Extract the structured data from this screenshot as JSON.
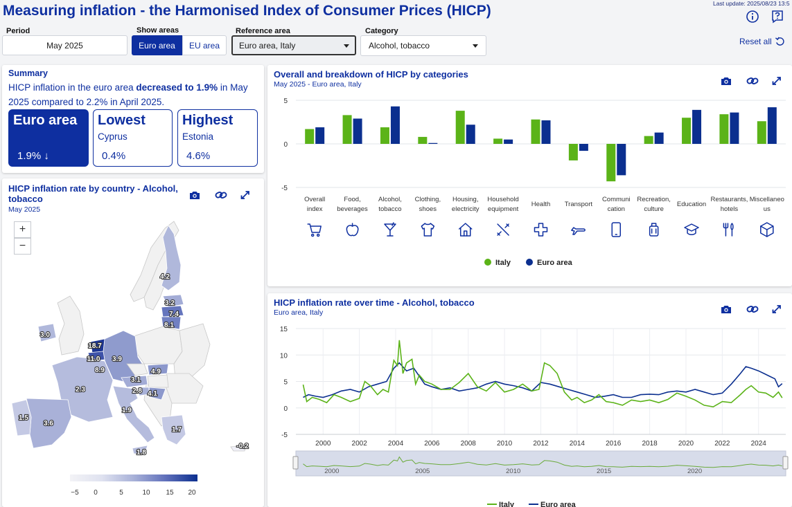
{
  "header": {
    "title": "Measuring inflation - the Harmonised Index of Consumer Prices (HICP)",
    "last_update": "Last update: 2025/08/23 13:5"
  },
  "controls": {
    "period_label": "Period",
    "period_value": "May 2025",
    "show_areas_label": "Show areas",
    "euro_area_btn": "Euro area",
    "eu_area_btn": "EU area",
    "reference_area_label": "Reference area",
    "reference_area_value": "Euro area, Italy",
    "category_label": "Category",
    "category_value": "Alcohol, tobacco",
    "reset_label": "Reset all"
  },
  "summary": {
    "title": "Summary",
    "text_pre": "HICP inflation in the euro area ",
    "text_bold": "decreased to 1.9%",
    "text_post": " in May 2025 compared to 2.2% in April 2025.",
    "cards": [
      {
        "head": "Euro area",
        "sub": "",
        "value": "1.9%",
        "arrow": "↓"
      },
      {
        "head": "Lowest",
        "sub": "Cyprus",
        "value": "0.4%"
      },
      {
        "head": "Highest",
        "sub": "Estonia",
        "value": "4.6%"
      }
    ]
  },
  "map_panel": {
    "title_pre": "HICP inflation rate by country - ",
    "title_bold": "Alcohol, tobacco",
    "subtitle": "May 2025",
    "zoom_in": "+",
    "zoom_out": "−",
    "legend_ticks": [
      "−5",
      "0",
      "5",
      "10",
      "15",
      "20"
    ],
    "labels": [
      "4.2",
      "3.2",
      "7.4",
      "8.1",
      "3.0",
      "18.7",
      "11.0",
      "8.9",
      "3.9",
      "4.9",
      "2.3",
      "3.1",
      "2.8",
      "4.1",
      "1.9",
      "1.5",
      "3.6",
      "1.7",
      "1.8",
      "-0.2"
    ]
  },
  "categories_panel": {
    "title_pre": "Overall and breakdown of HICP ",
    "title_bold": "by categories",
    "subtitle": "May 2025 - Euro area, Italy",
    "legend": [
      "Italy",
      "Euro area"
    ]
  },
  "time_panel": {
    "title_pre": "HICP inflation rate over time - ",
    "title_bold": "Alcohol, tobacco",
    "subtitle": "Euro area, Italy",
    "legend": [
      "Italy",
      "Euro area"
    ],
    "navigator_labels": [
      "2000",
      "2005",
      "2010",
      "2015",
      "2020"
    ]
  },
  "chart_data": [
    {
      "type": "bar",
      "categories": [
        "Overall index",
        "Food, beverages",
        "Alcohol, tobacco",
        "Clothing, shoes",
        "Housing, electricity",
        "Household equipment",
        "Health",
        "Transport",
        "Communication",
        "Recreation, culture",
        "Education",
        "Restaurants, hotels",
        "Miscellaneous"
      ],
      "category_lines": [
        [
          "Overall",
          "index"
        ],
        [
          "Food,",
          "beverages"
        ],
        [
          "Alcohol,",
          "tobacco"
        ],
        [
          "Clothing,",
          "shoes"
        ],
        [
          "Housing,",
          "electricity"
        ],
        [
          "Household",
          "equipment"
        ],
        [
          "Health"
        ],
        [
          "Transport"
        ],
        [
          "Communi",
          "cation"
        ],
        [
          "Recreation,",
          "culture"
        ],
        [
          "Education"
        ],
        [
          "Restaurants,",
          "hotels"
        ],
        [
          "Miscellaneo",
          "us"
        ]
      ],
      "icons": [
        "cart-icon",
        "apple-icon",
        "cocktail-icon",
        "shirt-icon",
        "house-icon",
        "tools-icon",
        "cross-icon",
        "plane-icon",
        "phone-icon",
        "suitcase-icon",
        "graduation-cap-icon",
        "cutlery-icon",
        "box-icon"
      ],
      "series": [
        {
          "name": "Italy",
          "color": "#5bb318",
          "values": [
            1.7,
            3.3,
            1.9,
            0.8,
            3.8,
            0.6,
            2.8,
            -1.9,
            -4.3,
            0.9,
            3.0,
            3.4,
            2.6
          ]
        },
        {
          "name": "Euro area",
          "color": "#0b2f8f",
          "values": [
            1.9,
            2.9,
            4.3,
            0.1,
            2.2,
            0.5,
            2.7,
            -0.8,
            -3.6,
            1.3,
            3.9,
            3.6,
            4.2
          ]
        }
      ],
      "ylim": [
        -5,
        5
      ],
      "yticks": [
        5,
        0,
        -5
      ]
    },
    {
      "type": "line",
      "xlim": [
        1998.5,
        2025.5
      ],
      "ylim": [
        -5,
        15
      ],
      "yticks": [
        15,
        10,
        5,
        0,
        -5
      ],
      "xticks": [
        2000,
        2002,
        2004,
        2006,
        2008,
        2010,
        2012,
        2014,
        2016,
        2018,
        2020,
        2022,
        2024
      ],
      "series": [
        {
          "name": "Italy",
          "color": "#5bb318",
          "x": [
            1998.9,
            1999.1,
            1999.4,
            1999.8,
            2000.2,
            2000.6,
            2001.0,
            2001.5,
            2002.0,
            2002.3,
            2002.6,
            2003.0,
            2003.3,
            2003.6,
            2003.9,
            2004.1,
            2004.2,
            2004.4,
            2004.6,
            2004.9,
            2005.1,
            2005.3,
            2005.6,
            2006.0,
            2006.5,
            2007.0,
            2007.5,
            2008.0,
            2008.5,
            2009.0,
            2009.5,
            2010.0,
            2010.5,
            2011.0,
            2011.5,
            2011.9,
            2012.2,
            2012.5,
            2012.9,
            2013.3,
            2013.7,
            2014.0,
            2014.4,
            2014.8,
            2015.2,
            2015.6,
            2016.0,
            2016.5,
            2017.0,
            2017.5,
            2018.0,
            2018.5,
            2019.0,
            2019.5,
            2020.0,
            2020.5,
            2021.0,
            2021.5,
            2022.0,
            2022.5,
            2023.0,
            2023.3,
            2023.6,
            2024.0,
            2024.4,
            2024.8,
            2025.1,
            2025.3
          ],
          "y": [
            4.4,
            1.2,
            2.0,
            1.6,
            1.0,
            2.5,
            2.0,
            1.2,
            1.8,
            5.0,
            4.2,
            2.5,
            3.5,
            3.0,
            9.0,
            8.0,
            12.8,
            6.5,
            8.5,
            9.2,
            4.5,
            6.2,
            5.0,
            4.5,
            3.5,
            3.5,
            4.8,
            6.5,
            4.0,
            3.2,
            4.8,
            3.0,
            3.5,
            4.5,
            3.2,
            3.5,
            8.5,
            8.0,
            6.5,
            3.0,
            1.5,
            2.0,
            1.0,
            1.5,
            2.5,
            1.2,
            1.0,
            0.5,
            1.5,
            1.2,
            1.5,
            1.0,
            1.6,
            2.8,
            2.2,
            1.5,
            0.5,
            0.2,
            1.2,
            1.0,
            2.5,
            3.5,
            4.2,
            3.0,
            2.8,
            2.0,
            3.0,
            1.9
          ]
        },
        {
          "name": "Euro area",
          "color": "#0b2f8f",
          "x": [
            1998.9,
            1999.2,
            1999.6,
            2000.0,
            2000.5,
            2001.0,
            2001.5,
            2002.0,
            2002.5,
            2003.0,
            2003.5,
            2003.9,
            2004.2,
            2004.6,
            2005.0,
            2005.3,
            2005.6,
            2006.0,
            2006.5,
            2007.0,
            2007.5,
            2008.0,
            2008.5,
            2009.0,
            2009.5,
            2010.0,
            2010.5,
            2011.0,
            2011.5,
            2012.0,
            2012.5,
            2013.0,
            2013.5,
            2014.0,
            2014.5,
            2015.0,
            2015.5,
            2016.0,
            2016.5,
            2017.0,
            2017.5,
            2018.0,
            2018.5,
            2019.0,
            2019.5,
            2020.0,
            2020.5,
            2021.0,
            2021.5,
            2022.0,
            2022.5,
            2023.0,
            2023.3,
            2023.6,
            2024.0,
            2024.3,
            2024.6,
            2024.9,
            2025.1,
            2025.3
          ],
          "y": [
            2.0,
            2.5,
            2.2,
            2.0,
            2.5,
            3.2,
            3.5,
            3.0,
            4.0,
            4.5,
            5.0,
            7.5,
            8.5,
            7.0,
            7.5,
            6.0,
            4.5,
            4.0,
            3.5,
            3.8,
            3.2,
            3.5,
            3.8,
            4.5,
            5.0,
            4.5,
            4.2,
            3.8,
            3.2,
            4.8,
            4.5,
            4.0,
            3.5,
            3.0,
            2.5,
            2.0,
            2.2,
            2.5,
            2.0,
            2.0,
            2.5,
            2.6,
            2.5,
            3.0,
            3.2,
            3.0,
            3.5,
            3.0,
            2.5,
            2.8,
            4.5,
            6.5,
            7.8,
            7.5,
            7.0,
            6.5,
            6.0,
            5.5,
            4.0,
            4.6
          ]
        }
      ]
    }
  ]
}
